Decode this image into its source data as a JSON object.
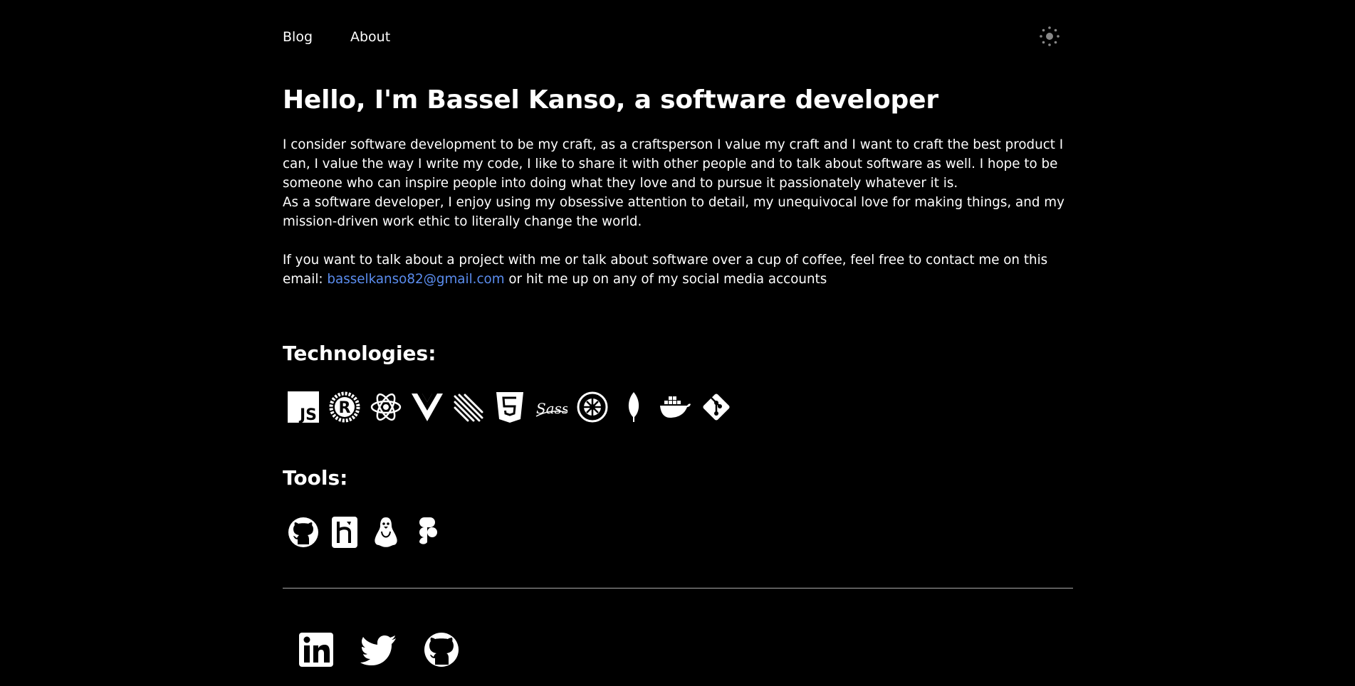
{
  "nav": {
    "blog": "Blog",
    "about": "About"
  },
  "hero": {
    "title": "Hello, I'm Bassel Kanso, a software developer",
    "p1": "I consider software development to be my craft, as a craftsperson I value my craft and I want to craft the best product I can, I value the way I write my code, I like to share it with other people and to talk about software as well. I hope to be someone who can inspire people into doing what they love and to pursue it passionately whatever it is.",
    "p2": "As a software developer, I enjoy using my obsessive attention to detail, my unequivocal love for making things, and my mission-driven work ethic to literally change the world.",
    "contact_prefix": "If you want to talk about a project with me or talk about software over a cup of coffee, feel free to contact me on this email: ",
    "email": "basselkanso82@gmail.com",
    "contact_suffix": " or hit me up on any of my social media accounts"
  },
  "technologies": {
    "title": "Technologies:",
    "icons": [
      "javascript-icon",
      "rust-icon",
      "react-icon",
      "vue-icon",
      "linear-icon",
      "html5-icon",
      "sass-icon",
      "jest-icon",
      "mongodb-icon",
      "docker-icon",
      "git-icon"
    ]
  },
  "tools": {
    "title": "Tools:",
    "icons": [
      "github-icon",
      "heroku-icon",
      "linux-icon",
      "figma-icon"
    ]
  },
  "social": {
    "icons": [
      "linkedin-icon",
      "twitter-icon",
      "github-icon"
    ]
  },
  "colors": {
    "background": "#000000",
    "text": "#ffffff",
    "link": "#5b8def"
  }
}
